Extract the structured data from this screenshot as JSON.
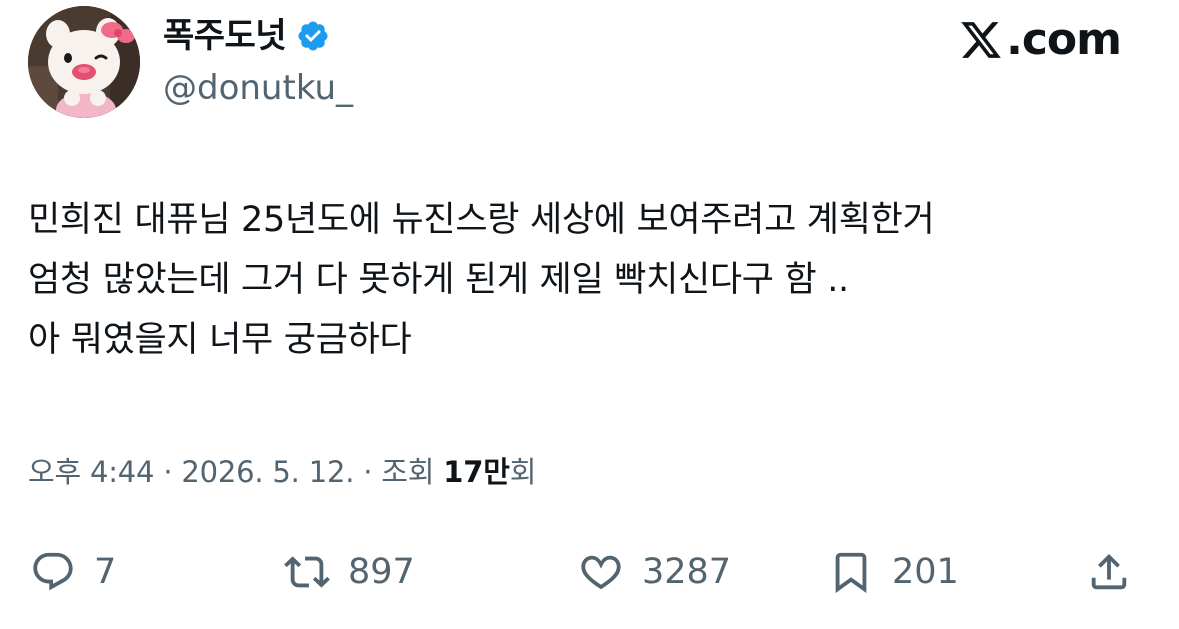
{
  "header": {
    "display_name": "폭주도넛",
    "handle": "@donutku_",
    "brand_text": ".com"
  },
  "tweet": {
    "lines": [
      "민희진 대퓨님 25년도에 뉴진스랑 세상에 보여주려고 계획한거",
      "엄청 많았는데 그거 다 못하게 된게 제일 빡치신다구 함 ..",
      "아 뭐였을지 너무 궁금하다"
    ]
  },
  "meta": {
    "time": "오후 4:44",
    "separator": " · ",
    "date": "2026. 5. 12.",
    "views_label_prefix": "조회 ",
    "views_count": "17만",
    "views_label_suffix": "회"
  },
  "actions": {
    "reply_count": "7",
    "retweet_count": "897",
    "like_count": "3287",
    "bookmark_count": "201"
  },
  "icons": {
    "verified": "verified-badge-icon",
    "reply": "reply-icon",
    "retweet": "retweet-icon",
    "like": "like-icon",
    "bookmark": "bookmark-icon",
    "share": "share-icon",
    "brand": "x-logo-icon"
  },
  "colors": {
    "text": "#0f1419",
    "secondary": "#536471",
    "verified": "#1d9bf0"
  }
}
